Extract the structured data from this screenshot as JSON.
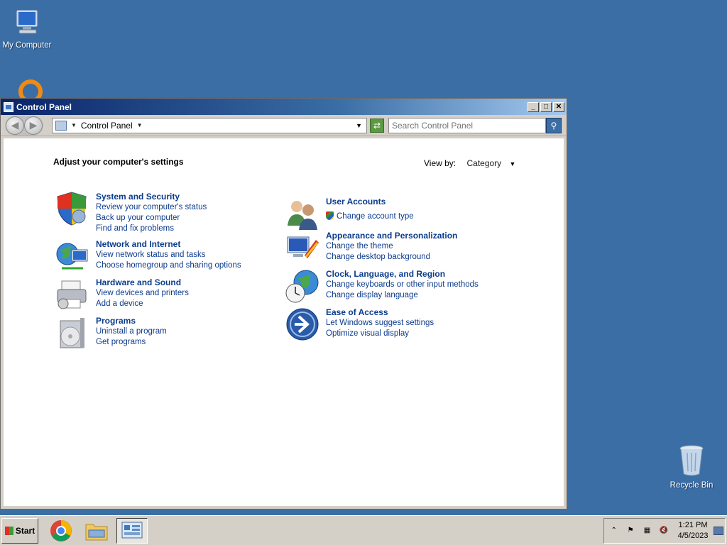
{
  "desktop": {
    "my_computer_label": "My Computer",
    "recycle_bin_label": "Recycle Bin"
  },
  "window": {
    "title": "Control Panel",
    "minimize": "_",
    "maximize": "□",
    "close": "✕"
  },
  "address": {
    "location": "Control Panel",
    "search_placeholder": "Search Control Panel"
  },
  "content": {
    "heading": "Adjust your computer's settings",
    "view_by_label": "View by:",
    "view_by_value": "Category"
  },
  "categories": [
    {
      "title": "System and Security",
      "links": [
        "Review your computer's status",
        "Back up your computer",
        "Find and fix problems"
      ],
      "icon": "shield-icon"
    },
    {
      "title": "Network and Internet",
      "links": [
        "View network status and tasks",
        "Choose homegroup and sharing options"
      ],
      "icon": "network-icon"
    },
    {
      "title": "Hardware and Sound",
      "links": [
        "View devices and printers",
        "Add a device"
      ],
      "icon": "printer-icon"
    },
    {
      "title": "Programs",
      "links": [
        "Uninstall a program",
        "Get programs"
      ],
      "icon": "programs-icon"
    },
    {
      "title": "User Accounts",
      "links": [
        "Change account type"
      ],
      "icon": "users-icon"
    },
    {
      "title": "Appearance and Personalization",
      "links": [
        "Change the theme",
        "Change desktop background"
      ],
      "icon": "appearance-icon"
    },
    {
      "title": "Clock, Language, and Region",
      "links": [
        "Change keyboards or other input methods",
        "Change display language"
      ],
      "icon": "clock-globe-icon"
    },
    {
      "title": "Ease of Access",
      "links": [
        "Let Windows suggest settings",
        "Optimize visual display"
      ],
      "icon": "ease-of-access-icon"
    }
  ],
  "taskbar": {
    "start_label": "Start",
    "time": "1:21 PM",
    "date": "4/5/2023"
  }
}
